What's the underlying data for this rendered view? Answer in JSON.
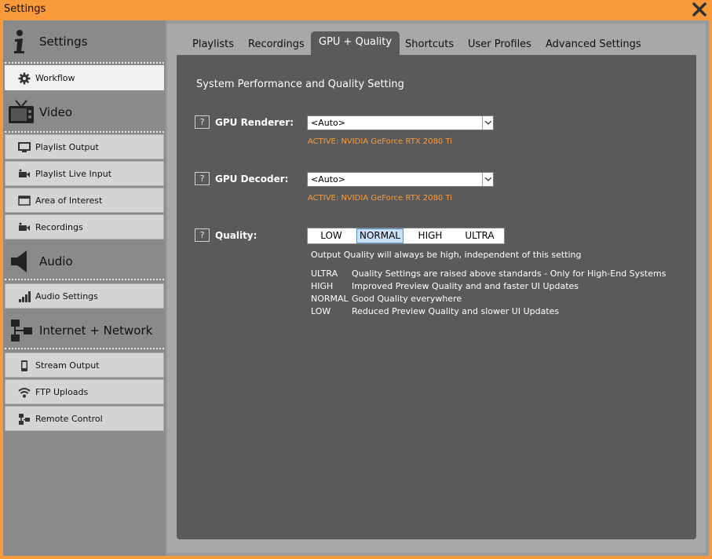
{
  "window": {
    "title": "Settings"
  },
  "sidebar": {
    "sections": [
      {
        "label": "Settings",
        "icon": "info-icon"
      },
      {
        "label": "Video",
        "icon": "tv-icon"
      },
      {
        "label": "Audio",
        "icon": "speaker-icon"
      },
      {
        "label": "Internet + Network",
        "icon": "network-icon"
      }
    ],
    "items": [
      {
        "label": "Workflow",
        "icon": "gear-icon",
        "active": true
      },
      {
        "label": "Playlist Output",
        "icon": "monitor-icon"
      },
      {
        "label": "Playlist Live Input",
        "icon": "camera-icon"
      },
      {
        "label": "Area of Interest",
        "icon": "frame-icon"
      },
      {
        "label": "Recordings",
        "icon": "camera-icon"
      },
      {
        "label": "Audio Settings",
        "icon": "bars-icon"
      },
      {
        "label": "Stream Output",
        "icon": "device-icon"
      },
      {
        "label": "FTP Uploads",
        "icon": "wifi-icon"
      },
      {
        "label": "Remote Control",
        "icon": "network-icon"
      }
    ]
  },
  "tabs": [
    {
      "label": "Playlists"
    },
    {
      "label": "Recordings"
    },
    {
      "label": "GPU + Quality",
      "active": true
    },
    {
      "label": "Shortcuts"
    },
    {
      "label": "User Profiles"
    },
    {
      "label": "Advanced Settings"
    }
  ],
  "content": {
    "title": "System Performance and Quality Setting",
    "help_label": "?",
    "gpu_renderer": {
      "label": "GPU Renderer:",
      "value": "<Auto>",
      "active": "ACTIVE:  NVIDIA GeForce RTX 2080 Ti"
    },
    "gpu_decoder": {
      "label": "GPU Decoder:",
      "value": "<Auto>",
      "active": "ACTIVE:  NVIDIA GeForce RTX 2080 Ti"
    },
    "quality": {
      "label": "Quality:",
      "options": [
        "LOW",
        "NORMAL",
        "HIGH",
        "ULTRA"
      ],
      "selected": "NORMAL",
      "note": "Output Quality will always be high, independent of this setting",
      "descriptions": [
        {
          "level": "ULTRA",
          "text": "Quality Settings are raised above standards - Only for High-End Systems"
        },
        {
          "level": "HIGH",
          "text": "Improved Preview Quality and and faster UI Updates"
        },
        {
          "level": "NORMAL",
          "text": "Good Quality everywhere"
        },
        {
          "level": "LOW",
          "text": "Reduced Preview Quality and slower UI Updates"
        }
      ]
    }
  },
  "colors": {
    "accent": "#f99a3a",
    "panel": "#5a5a5a",
    "sidebar": "#8a8a8a",
    "selection": "#c9def7"
  }
}
